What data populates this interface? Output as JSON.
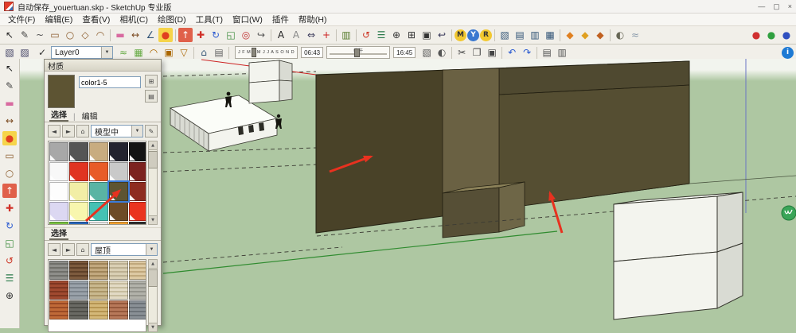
{
  "window": {
    "title": "自动保存_youertuan.skp - SketchUp 专业版",
    "minimize": "—",
    "maximize": "▢",
    "close": "×"
  },
  "glyphs": {
    "up": "▲",
    "down": "▼",
    "down_small": "▼",
    "left": "◄",
    "right": "►",
    "home": "⌂",
    "brush": "✎",
    "create": "⊞",
    "panes": "▤",
    "pipe": "|",
    "check": "✓"
  },
  "menu": {
    "items": [
      {
        "id": "file",
        "label": "文件(F)"
      },
      {
        "id": "edit",
        "label": "编辑(E)"
      },
      {
        "id": "view",
        "label": "查看(V)"
      },
      {
        "id": "camera",
        "label": "相机(C)"
      },
      {
        "id": "draw",
        "label": "绘图(D)"
      },
      {
        "id": "tools",
        "label": "工具(T)"
      },
      {
        "id": "window",
        "label": "窗口(W)"
      },
      {
        "id": "plugins",
        "label": "插件"
      },
      {
        "id": "help",
        "label": "帮助(H)"
      }
    ]
  },
  "toolbar1": {
    "icons": [
      {
        "name": "select-tool-icon",
        "glyph": "↖",
        "fg": "#222222"
      },
      {
        "name": "line-tool-icon",
        "glyph": "✎",
        "fg": "#444444"
      },
      {
        "name": "freehand-tool-icon",
        "glyph": "~",
        "fg": "#555555"
      },
      {
        "name": "rectangle-tool-icon",
        "glyph": "▭",
        "fg": "#8a5a2a"
      },
      {
        "name": "circle-tool-icon",
        "glyph": "○",
        "fg": "#8a5a2a"
      },
      {
        "name": "polygon-tool-icon",
        "glyph": "◇",
        "fg": "#8a5a2a"
      },
      {
        "name": "arc-tool-icon",
        "glyph": "◠",
        "fg": "#8a5a2a"
      },
      {
        "sep": true
      },
      {
        "name": "eraser-tool-icon",
        "glyph": "▬",
        "fg": "#d86aa0"
      },
      {
        "name": "tape-measure-tool-icon",
        "glyph": "↔",
        "fg": "#7a4a20"
      },
      {
        "name": "protractor-tool-icon",
        "glyph": "∠",
        "fg": "#335577"
      },
      {
        "name": "paint-bucket-tool-icon",
        "glyph": "●",
        "fg": "#e04020",
        "bg": "#f6d44a"
      },
      {
        "sep": true
      },
      {
        "name": "push-pull-tool-icon",
        "glyph": "↑",
        "fg": "#ffffff",
        "bg": "#e0604a"
      },
      {
        "name": "move-tool-icon",
        "glyph": "✚",
        "fg": "#d03028"
      },
      {
        "name": "rotate-tool-icon",
        "glyph": "↻",
        "fg": "#2a5ad0"
      },
      {
        "name": "scale-tool-icon",
        "glyph": "◱",
        "fg": "#3a8a3a"
      },
      {
        "name": "offset-tool-icon",
        "glyph": "◎",
        "fg": "#c03030"
      },
      {
        "name": "follow-me-tool-icon",
        "glyph": "↪",
        "fg": "#555555"
      },
      {
        "sep": true
      },
      {
        "name": "text-tool-icon",
        "glyph": "A",
        "fg": "#222222"
      },
      {
        "name": "3d-text-tool-icon",
        "glyph": "A",
        "fg": "#888888"
      },
      {
        "name": "dimension-tool-icon",
        "glyph": "⇔",
        "fg": "#333355"
      },
      {
        "name": "axes-tool-icon",
        "glyph": "+",
        "fg": "#cc2020"
      },
      {
        "sep": true
      },
      {
        "name": "section-plane-tool-icon",
        "glyph": "▥",
        "fg": "#557a2a"
      },
      {
        "sep": true
      },
      {
        "name": "orbit-tool-icon",
        "glyph": "↺",
        "fg": "#cc3322"
      },
      {
        "name": "pan-tool-icon",
        "glyph": "☰",
        "fg": "#2a7a4a"
      },
      {
        "name": "zoom-tool-icon",
        "glyph": "⊕",
        "fg": "#333333"
      },
      {
        "name": "zoom-window-tool-icon",
        "glyph": "⊞",
        "fg": "#333333"
      },
      {
        "name": "zoom-extents-tool-icon",
        "glyph": "▣",
        "fg": "#333333"
      },
      {
        "name": "previous-view-tool-icon",
        "glyph": "↩",
        "fg": "#333355"
      },
      {
        "sep": true
      },
      {
        "name": "position-camera-tool-icon",
        "glyph": "M",
        "fg": "#333333",
        "bg": "#f2c830",
        "round": true
      },
      {
        "name": "walk-tool-icon",
        "glyph": "Y",
        "fg": "#ffffff",
        "bg": "#3a78d0",
        "round": true
      },
      {
        "name": "look-around-tool-icon",
        "glyph": "R",
        "fg": "#333333",
        "bg": "#f2c830",
        "round": true
      },
      {
        "sep": true
      },
      {
        "name": "view-iso-icon",
        "glyph": "▧",
        "fg": "#335577"
      },
      {
        "name": "view-top-icon",
        "glyph": "▤",
        "fg": "#335577"
      },
      {
        "name": "view-front-icon",
        "glyph": "▥",
        "fg": "#335577"
      },
      {
        "name": "view-side-icon",
        "glyph": "▦",
        "fg": "#335577"
      },
      {
        "sep": true
      },
      {
        "name": "3d-warehouse-icon",
        "glyph": "◆",
        "fg": "#e08020"
      },
      {
        "name": "share-model-icon",
        "glyph": "◆",
        "fg": "#e0a020"
      },
      {
        "name": "extension-warehouse-icon",
        "glyph": "◆",
        "fg": "#c06020"
      },
      {
        "sep": true
      },
      {
        "name": "shadows-toggle-icon",
        "glyph": "◐",
        "fg": "#666655"
      },
      {
        "name": "fog-toggle-icon",
        "glyph": "≈",
        "fg": "#8899aa"
      },
      {
        "spacer": true
      },
      {
        "name": "red-sphere-icon",
        "glyph": "●",
        "fg": "#d03030"
      },
      {
        "name": "green-sphere-icon",
        "glyph": "●",
        "fg": "#30a040"
      },
      {
        "name": "blue-sphere-icon",
        "glyph": "●",
        "fg": "#3050c0"
      }
    ]
  },
  "toolbar2": {
    "left_icons": [
      {
        "name": "standard-views-icon",
        "glyph": "▧",
        "fg": "#444466"
      },
      {
        "name": "shaded-with-textures-icon",
        "glyph": "▨",
        "fg": "#444466"
      }
    ],
    "layer": {
      "check": "✓",
      "value": "Layer0"
    },
    "mid_icons": [
      {
        "name": "sandbox-from-contours-icon",
        "glyph": "≈",
        "fg": "#66aa44"
      },
      {
        "name": "sandbox-from-scratch-icon",
        "glyph": "▦",
        "fg": "#66aa44"
      },
      {
        "name": "smoove-icon",
        "glyph": "◠",
        "fg": "#aa6600"
      },
      {
        "name": "stamp-icon",
        "glyph": "▣",
        "fg": "#aa6600"
      },
      {
        "name": "drape-icon",
        "glyph": "▽",
        "fg": "#aa6600"
      },
      {
        "sep": true
      },
      {
        "name": "add-building-icon",
        "glyph": "⌂",
        "fg": "#335577"
      },
      {
        "name": "section-slice-icon",
        "glyph": "▤",
        "fg": "#666666"
      },
      {
        "sep": true
      }
    ],
    "shadows": {
      "months": "J F M A M J J A S O N D",
      "start": "06:43",
      "noon": "中午",
      "end": "16:45"
    },
    "right_icons": [
      {
        "name": "shadow-display-icon",
        "glyph": "▧",
        "fg": "#555555"
      },
      {
        "name": "shadow-dialog-icon",
        "glyph": "◐",
        "fg": "#555555"
      },
      {
        "sep": true
      },
      {
        "name": "cut-icon",
        "glyph": "✂",
        "fg": "#444444"
      },
      {
        "name": "copy-icon",
        "glyph": "❐",
        "fg": "#444444"
      },
      {
        "name": "paste-icon",
        "glyph": "▣",
        "fg": "#444444"
      },
      {
        "sep": true
      },
      {
        "name": "undo-icon",
        "glyph": "↶",
        "fg": "#2a5ad0"
      },
      {
        "name": "redo-icon",
        "glyph": "↷",
        "fg": "#2a5ad0"
      },
      {
        "sep": true
      },
      {
        "name": "print-icon",
        "glyph": "▤",
        "fg": "#555555"
      },
      {
        "name": "model-info-icon",
        "glyph": "▥",
        "fg": "#555555"
      },
      {
        "spacer": true
      },
      {
        "name": "instructor-icon",
        "glyph": "i",
        "fg": "#ffffff",
        "bg": "#1e7ad4",
        "round": true
      }
    ]
  },
  "left_toolbar": {
    "icons": [
      {
        "name": "select-tool-icon",
        "glyph": "↖",
        "fg": "#222222"
      },
      {
        "name": "line-tool-icon",
        "glyph": "✎",
        "fg": "#444444"
      },
      {
        "name": "eraser-tool-icon",
        "glyph": "▬",
        "fg": "#d86aa0"
      },
      {
        "name": "tape-measure-tool-icon",
        "glyph": "↔",
        "fg": "#7a4a20"
      },
      {
        "name": "paint-bucket-tool-icon",
        "glyph": "●",
        "fg": "#e04020",
        "bg": "#f6d44a"
      },
      {
        "name": "rectangle-tool-icon",
        "glyph": "▭",
        "fg": "#8a5a2a"
      },
      {
        "name": "circle-tool-icon",
        "glyph": "○",
        "fg": "#8a5a2a"
      },
      {
        "name": "push-pull-tool-icon",
        "glyph": "↑",
        "fg": "#ffffff",
        "bg": "#e0604a"
      },
      {
        "name": "move-tool-icon",
        "glyph": "✚",
        "fg": "#d03028"
      },
      {
        "name": "rotate-tool-icon",
        "glyph": "↻",
        "fg": "#2a5ad0"
      },
      {
        "name": "scale-tool-icon",
        "glyph": "◱",
        "fg": "#3a8a3a"
      },
      {
        "name": "orbit-tool-icon",
        "glyph": "↺",
        "fg": "#cc3322"
      },
      {
        "name": "pan-tool-icon",
        "glyph": "☰",
        "fg": "#2a7a4a"
      },
      {
        "name": "zoom-tool-icon",
        "glyph": "⊕",
        "fg": "#333333"
      }
    ]
  },
  "materials_panel": {
    "title": "材质",
    "name_value": "color1-5",
    "preview_color": "#5d5433",
    "tabs": [
      "选择",
      "编辑"
    ],
    "collection_value": "模型中",
    "second_label": "选择",
    "collection2_value": "屋顶",
    "swatches": [
      {
        "name": "swatch-gray",
        "color": "#a8a8a8"
      },
      {
        "name": "swatch-dark-gray",
        "color": "#555555"
      },
      {
        "name": "swatch-tan",
        "color": "#c8ac80"
      },
      {
        "name": "swatch-blue-black",
        "color": "#23232f"
      },
      {
        "name": "swatch-black",
        "color": "#141414"
      },
      {
        "name": "swatch-white",
        "color": "#f8f8f8"
      },
      {
        "name": "swatch-red",
        "color": "#e03422"
      },
      {
        "name": "swatch-orange-red",
        "color": "#e85c28"
      },
      {
        "name": "swatch-silver",
        "color": "#c9c9c9"
      },
      {
        "name": "swatch-maroon",
        "color": "#7c2320"
      },
      {
        "name": "swatch-white-2",
        "color": "#fdfdfd"
      },
      {
        "name": "swatch-pale-yellow",
        "color": "#f2eea6"
      },
      {
        "name": "swatch-teal",
        "color": "#5ab4a4"
      },
      {
        "name": "swatch-color1-5-selected",
        "color": "#5d5433",
        "selected": true
      },
      {
        "name": "swatch-dark-red",
        "color": "#8e2c20"
      },
      {
        "name": "swatch-lavender",
        "color": "#dcd8f2"
      },
      {
        "name": "swatch-light-yellow",
        "color": "#f8f6ae"
      },
      {
        "name": "swatch-turquoise",
        "color": "#45c2b4"
      },
      {
        "name": "swatch-brown",
        "color": "#6d4b26"
      },
      {
        "name": "swatch-bright-red",
        "color": "#ea3420"
      },
      {
        "name": "swatch-green",
        "color": "#7ac143"
      },
      {
        "name": "swatch-blue",
        "color": "#2a66b8"
      },
      {
        "name": "swatch-light-gray",
        "color": "#e8e8e8"
      },
      {
        "name": "swatch-orange",
        "color": "#f0a030"
      },
      {
        "name": "swatch-charcoal",
        "color": "#303030"
      }
    ],
    "textures": [
      {
        "name": "texture-gray-shingles",
        "c1": "#8e8e8a",
        "c2": "#6f6f6a"
      },
      {
        "name": "texture-brown-shingles",
        "c1": "#7d5b3e",
        "c2": "#5e4028"
      },
      {
        "name": "texture-tan-shingles",
        "c1": "#c2a87e",
        "c2": "#a08559"
      },
      {
        "name": "texture-pale-shingles",
        "c1": "#d9cfb4",
        "c2": "#bcb092"
      },
      {
        "name": "texture-beige-tiles",
        "c1": "#ddc9a2",
        "c2": "#c0a87c"
      },
      {
        "name": "texture-red-tiles",
        "c1": "#a04a30",
        "c2": "#7e3620"
      },
      {
        "name": "texture-blue-gray-shingles",
        "c1": "#9aa2aa",
        "c2": "#7c848c"
      },
      {
        "name": "texture-tan-weave",
        "c1": "#c9b88e",
        "c2": "#ab9668"
      },
      {
        "name": "texture-light-shake",
        "c1": "#e2dac4",
        "c2": "#c6bc9e"
      },
      {
        "name": "texture-gray-pavers",
        "c1": "#b2b2aa",
        "c2": "#94948c"
      },
      {
        "name": "texture-orange-brick",
        "c1": "#c06a38",
        "c2": "#9a4a24"
      },
      {
        "name": "texture-dark-shingles",
        "c1": "#6a6a64",
        "c2": "#4e4e48"
      },
      {
        "name": "texture-straw-thatch",
        "c1": "#d4b878",
        "c2": "#b69552"
      },
      {
        "name": "texture-clay-tiles",
        "c1": "#b8795a",
        "c2": "#95583c"
      },
      {
        "name": "texture-slate",
        "c1": "#8a9096",
        "c2": "#6c7278"
      }
    ]
  },
  "scene": {
    "colors": {
      "ground": "#aec7a2",
      "sky": "#f2f4ee",
      "building_left": "#494228",
      "building_recess": "#6a6143",
      "building_right": "#554e32",
      "building_top_band": "#4f4930",
      "step_top": "#8b8159",
      "step_front": "#564f36",
      "step_side": "#6e6647",
      "white_face": "#f3f4ee",
      "white_side": "#d9dbd3",
      "white_top": "#fbfdf8",
      "edge": "#23201 2",
      "guide": "#3c3c34",
      "red_axis": "#cc2020",
      "green_axis": "#2f8b2f",
      "blue_axis": "#6a74c4",
      "arrow_red": "#e8311f",
      "badge_green": "#3aa558"
    }
  }
}
